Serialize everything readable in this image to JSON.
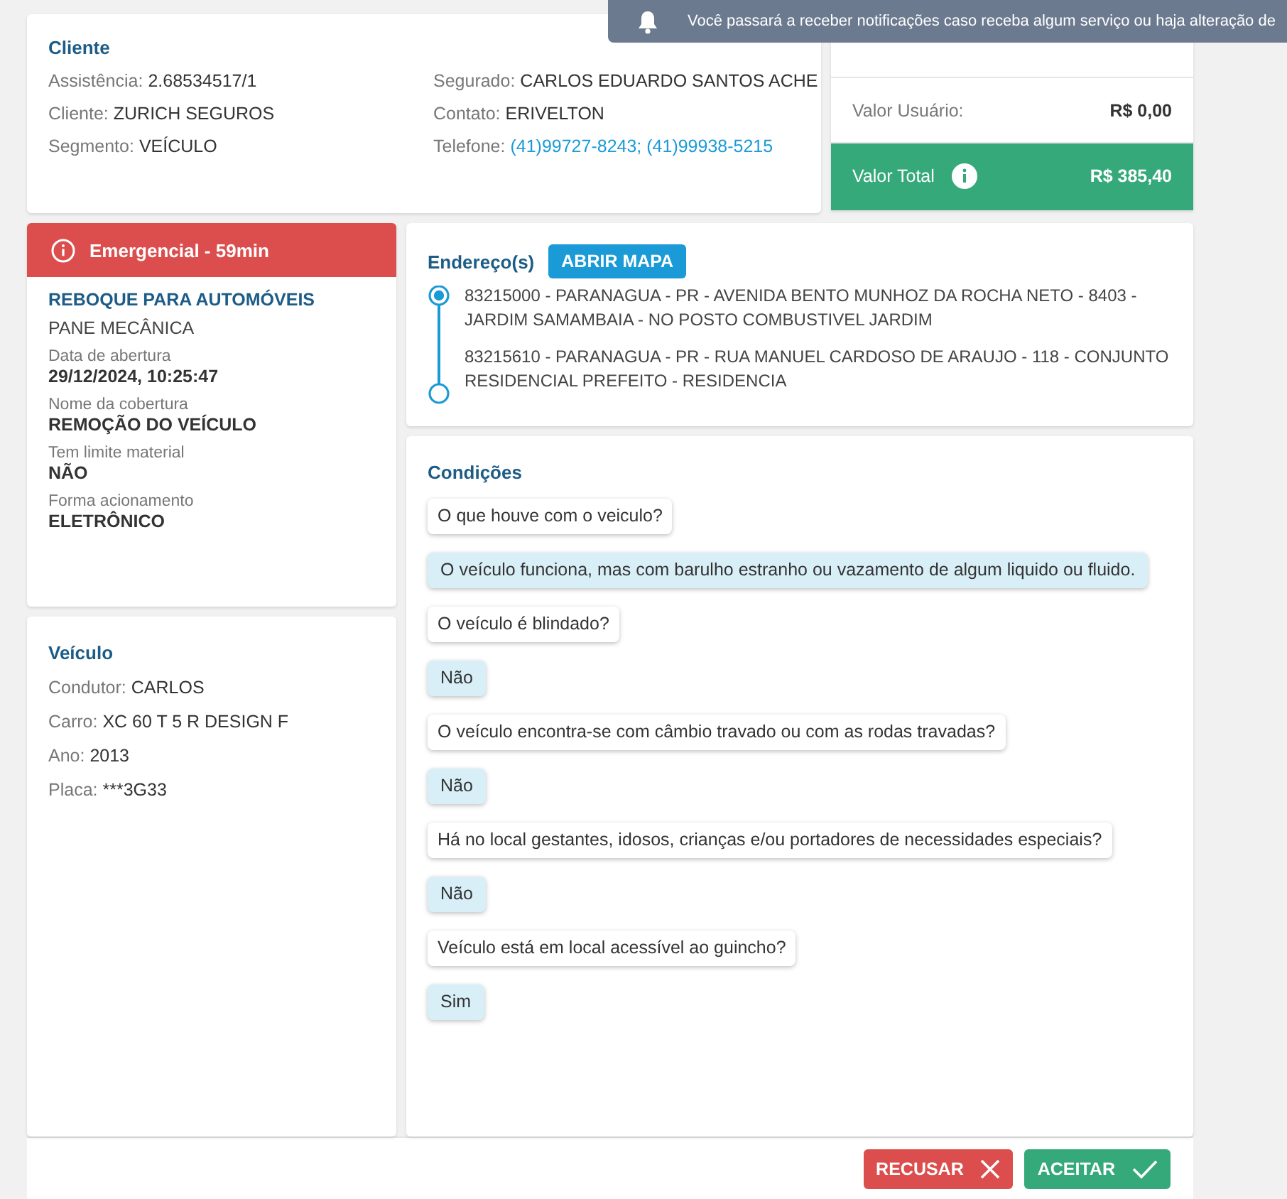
{
  "notification": {
    "text": "Você passará a receber notificações caso receba algum serviço ou haja alteração de"
  },
  "cliente": {
    "title": "Cliente",
    "fields": [
      {
        "label": "Assistência:",
        "value": "2.68534517/1",
        "link": false
      },
      {
        "label": "Segurado:",
        "value": "CARLOS EDUARDO SANTOS ACHE",
        "link": false
      },
      {
        "label": "Cliente:",
        "value": "ZURICH SEGUROS",
        "link": false
      },
      {
        "label": "Contato:",
        "value": "ERIVELTON",
        "link": false
      },
      {
        "label": "Segmento:",
        "value": "VEÍCULO",
        "link": false
      },
      {
        "label": "Telefone:",
        "value": "(41)99727-8243; (41)99938-5215",
        "link": true
      }
    ]
  },
  "valores": [
    {
      "label": "Valor Usuário:",
      "value": "R$ 0,00",
      "kind": "plain"
    },
    {
      "label": "Valor Total",
      "value": "R$ 385,40",
      "kind": "total"
    }
  ],
  "servico": {
    "alert": "Emergencial - 59min",
    "title": "REBOQUE PARA AUTOMÓVEIS",
    "subtitle": "PANE MECÂNICA",
    "fields": [
      {
        "label": "Data de abertura",
        "value": "29/12/2024, 10:25:47"
      },
      {
        "label": "Nome da cobertura",
        "value": "REMOÇÃO DO VEÍCULO"
      },
      {
        "label": "Tem limite material",
        "value": "NÃO"
      },
      {
        "label": "Forma acionamento",
        "value": "ELETRÔNICO"
      }
    ]
  },
  "veiculo": {
    "title": "Veículo",
    "fields": [
      {
        "label": "Condutor:",
        "value": "CARLOS"
      },
      {
        "label": "Carro:",
        "value": "XC 60 T 5 R DESIGN F"
      },
      {
        "label": "Ano:",
        "value": "2013"
      },
      {
        "label": "Placa:",
        "value": "***3G33"
      }
    ]
  },
  "enderecos": {
    "title": "Endereço(s)",
    "button": "ABRIR MAPA",
    "items": [
      {
        "kind": "origin",
        "text": "83215000 - PARANAGUA - PR - AVENIDA BENTO MUNHOZ DA ROCHA NETO - 8403 - JARDIM SAMAMBAIA - NO POSTO COMBUSTIVEL JARDIM"
      },
      {
        "kind": "destination",
        "text": "83215610 - PARANAGUA - PR - RUA MANUEL CARDOSO DE ARAUJO - 118 - CONJUNTO RESIDENCIAL PREFEITO - RESIDENCIA"
      }
    ]
  },
  "condicoes": {
    "title": "Condições",
    "items": [
      {
        "kind": "question",
        "text": "O que houve com o veiculo?"
      },
      {
        "kind": "answer",
        "text": "O veículo funciona, mas com barulho estranho ou vazamento de algum liquido ou fluido."
      },
      {
        "kind": "question",
        "text": "O veículo é blindado?"
      },
      {
        "kind": "answer",
        "text": "Não"
      },
      {
        "kind": "question",
        "text": "O veículo encontra-se com câmbio travado ou com as rodas travadas?"
      },
      {
        "kind": "answer",
        "text": "Não"
      },
      {
        "kind": "question",
        "text": "Há no local gestantes, idosos, crianças e/ou portadores de necessidades especiais?"
      },
      {
        "kind": "answer",
        "text": "Não"
      },
      {
        "kind": "question",
        "text": "Veículo está em local acessível ao guincho?"
      },
      {
        "kind": "answer",
        "text": "Sim"
      }
    ]
  },
  "actions": [
    {
      "kind": "reject",
      "label": "RECUSAR"
    },
    {
      "kind": "accept",
      "label": "ACEITAR"
    }
  ]
}
